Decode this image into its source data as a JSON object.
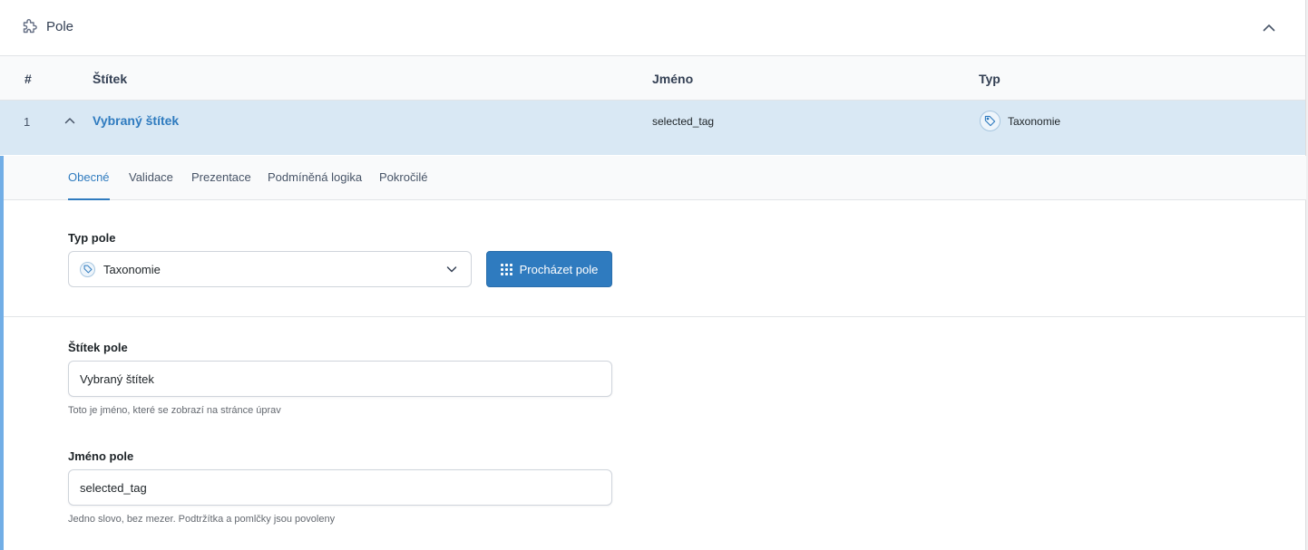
{
  "header": {
    "title": "Pole",
    "icon": "puzzle-icon",
    "collapse_icon": "chevron-up-icon"
  },
  "table": {
    "columns": {
      "num": "#",
      "label": "Štítek",
      "name": "Jméno",
      "type": "Typ"
    }
  },
  "row": {
    "num": "1",
    "label": "Vybraný štítek",
    "name": "selected_tag",
    "type": "Taxonomie",
    "type_icon": "tag-icon"
  },
  "tabs": [
    "Obecné",
    "Validace",
    "Prezentace",
    "Podmíněná logika",
    "Pokročilé"
  ],
  "active_tab": "Obecné",
  "field_type": {
    "label": "Typ pole",
    "value": "Taxonomie",
    "browse_label": "Procházet pole"
  },
  "field_label": {
    "label": "Štítek pole",
    "value": "Vybraný štítek",
    "hint": "Toto je jméno, které se zobrazí na stránce úprav"
  },
  "field_name": {
    "label": "Jméno pole",
    "value": "selected_tag",
    "hint": "Jedno slovo, bez mezer. Podtržítka a pomlčky jsou povoleny"
  },
  "colors": {
    "accent": "#2f7bbf",
    "row_highlight": "#d9e8f4",
    "left_border": "#72aee6"
  }
}
